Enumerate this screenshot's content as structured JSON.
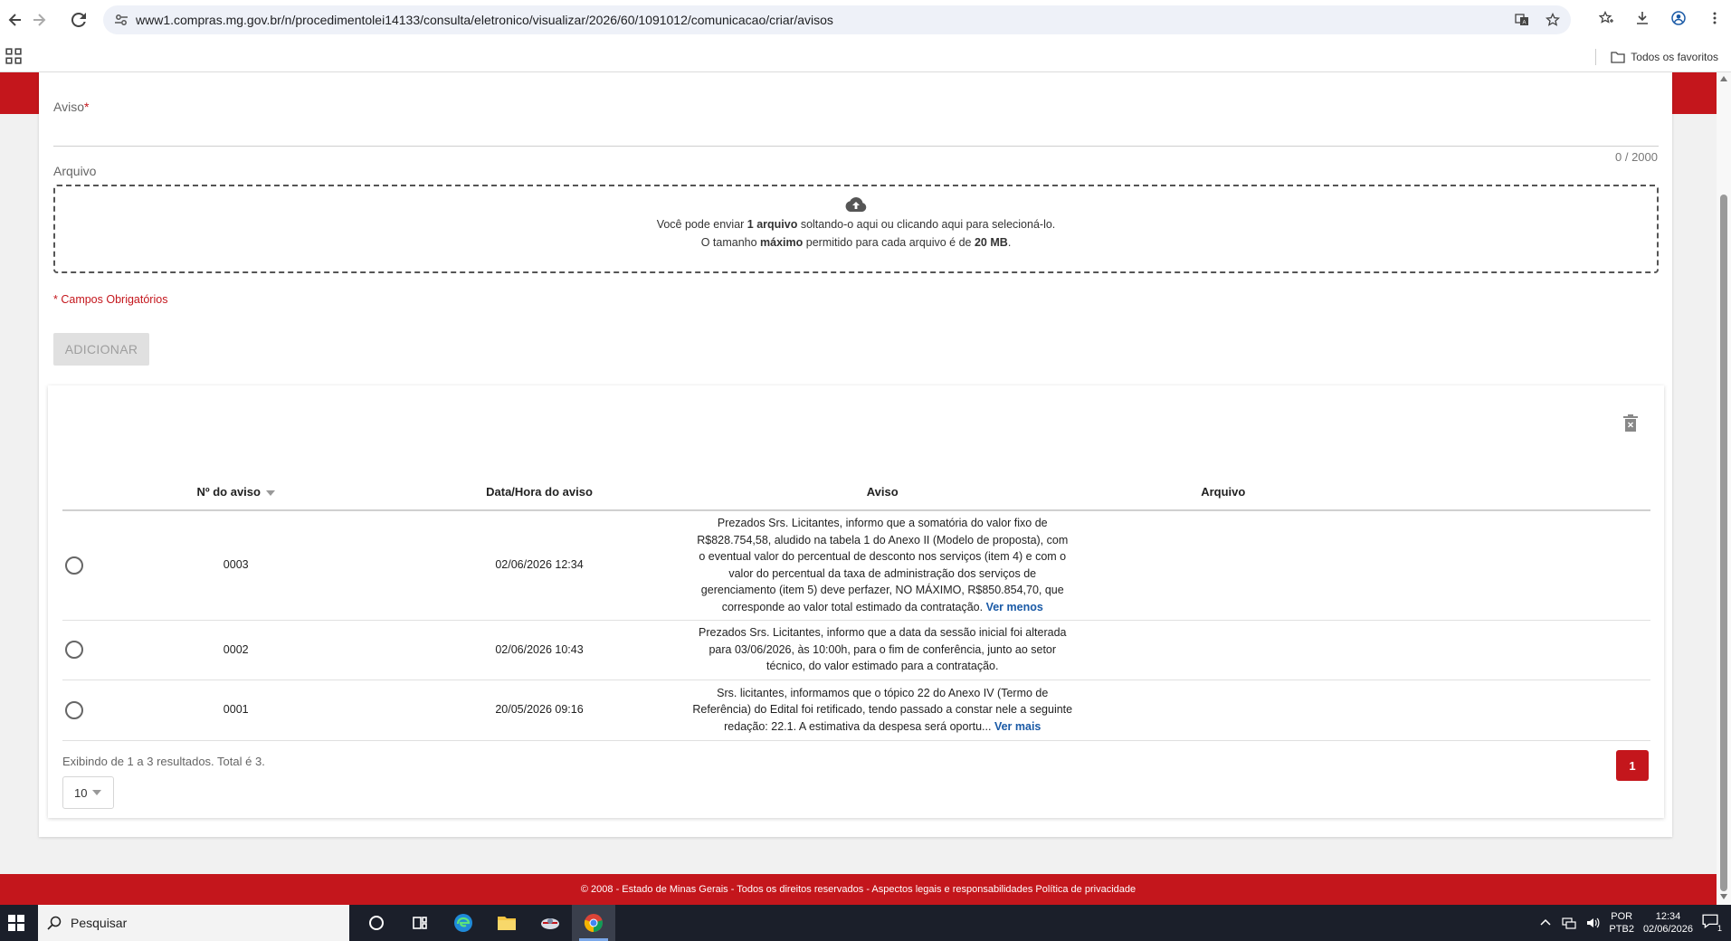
{
  "browser": {
    "url": "www1.compras.mg.gov.br/n/procedimentolei14133/consulta/eletronico/visualizar/2026/60/1091012/comunicacao/criar/avisos",
    "bookmarks_all": "Todos os favoritos"
  },
  "form": {
    "aviso_label": "Aviso",
    "required_mark": "*",
    "aviso_value": "",
    "counter": "0 / 2000",
    "arquivo_label": "Arquivo",
    "drop_line1_a": "Você pode enviar ",
    "drop_line1_b": "1 arquivo",
    "drop_line1_c": " soltando-o aqui ou clicando aqui para selecioná-lo.",
    "drop_line2_a": "O tamanho ",
    "drop_line2_b": "máximo",
    "drop_line2_c": " permitido para cada arquivo é de ",
    "drop_line2_d": "20 MB",
    "drop_line2_e": ".",
    "required_note": "* Campos Obrigatórios",
    "add_button": "ADICIONAR"
  },
  "table": {
    "headers": [
      "Nº do aviso",
      "Data/Hora do aviso",
      "Aviso",
      "Arquivo"
    ],
    "rows": [
      {
        "numero": "0003",
        "data": "02/06/2026 12:34",
        "aviso": "Prezados Srs. Licitantes, informo que a somatória do valor fixo de R$828.754,58, aludido na tabela 1 do Anexo II (Modelo de proposta), com o eventual valor do percentual de desconto nos serviços (item 4) e com o valor do percentual da taxa de administração dos serviços de gerenciamento (item 5) deve perfazer, NO MÁXIMO, R$850.854,70, que corresponde ao valor total estimado da contratação.",
        "link": "Ver menos",
        "arquivo": ""
      },
      {
        "numero": "0002",
        "data": "02/06/2026 10:43",
        "aviso": "Prezados Srs. Licitantes, informo que a data da sessão inicial foi alterada para 03/06/2026, às 10:00h, para o fim de conferência, junto ao setor técnico, do valor estimado para a contratação.",
        "link": "",
        "arquivo": ""
      },
      {
        "numero": "0001",
        "data": "20/05/2026 09:16",
        "aviso": "Srs. licitantes, informamos que o tópico 22 do Anexo IV (Termo de Referência) do Edital foi retificado, tendo passado a constar nele a seguinte redação: 22.1. A estimativa da despesa será oportu...",
        "link": "Ver mais",
        "arquivo": ""
      }
    ],
    "results_text": "Exibindo de 1 a 3 resultados. Total é 3.",
    "page_size": "10",
    "current_page": "1"
  },
  "footer": {
    "text": "© 2008 - Estado de Minas Gerais - Todos os direitos reservados -  Aspectos legais e responsabilidades  Política de privacidade"
  },
  "taskbar": {
    "search_placeholder": "Pesquisar",
    "lang_top": "POR",
    "lang_bottom": "PTB2",
    "time": "12:34",
    "date": "02/06/2026",
    "notifications": "1"
  },
  "colors": {
    "brand_red": "#c4161c",
    "link_blue": "#1a5aa6"
  }
}
